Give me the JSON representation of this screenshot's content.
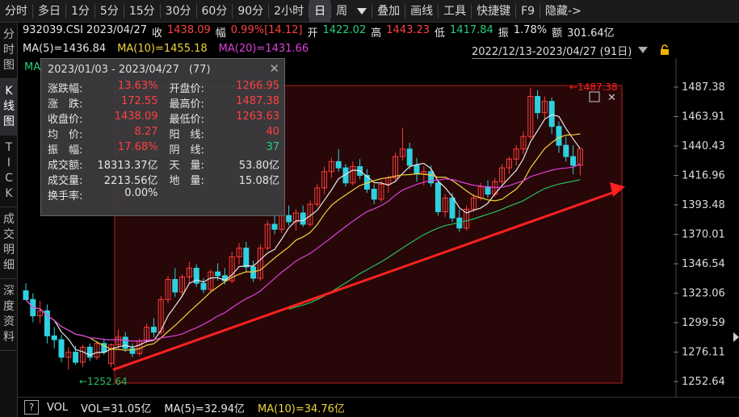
{
  "toolbar": {
    "items": [
      "分时",
      "多日",
      "1分",
      "5分",
      "15分",
      "30分",
      "60分",
      "90分",
      "2小时",
      "日",
      "周",
      "叠加",
      "画线",
      "工具",
      "快捷键",
      "F9",
      "隐藏->"
    ],
    "active": "日"
  },
  "leftbar": {
    "items": [
      "分时图",
      "K线图",
      "TICK",
      "成交明细",
      "深度资料"
    ],
    "active": "K线图"
  },
  "info": {
    "code_date": "932039.CSI 2023/04/27",
    "close_label": "收",
    "close": "1438.09",
    "change_label": "幅",
    "change": "0.99%[14.12]",
    "open_label": "开",
    "open": "1422.02",
    "high_label": "高",
    "high": "1443.23",
    "low_label": "低",
    "low": "1417.84",
    "amp_label": "振",
    "amp": "1.78%",
    "amount_label": "额",
    "amount": "301.64亿"
  },
  "ma": {
    "ma5": "MA(5)=1436.84",
    "ma10": "MA(10)=1455.18",
    "ma20": "MA(20)=1431.66",
    "ma_short": "MA"
  },
  "range": {
    "label": "2022/12/13-2023/04/27 (91日)"
  },
  "popup": {
    "start": "2023/01/03",
    "end": "2023/04/27",
    "count": "(77)",
    "rows": [
      [
        {
          "label": "涨跌幅:",
          "value": "13.63%",
          "color": "#ff4040"
        },
        {
          "label": "开盘价:",
          "value": "1266.95",
          "color": "#ff4040"
        }
      ],
      [
        {
          "label": "涨　跌:",
          "value": "172.55",
          "color": "#ff4040"
        },
        {
          "label": "最高价:",
          "value": "1487.38",
          "color": "#ff4040"
        }
      ],
      [
        {
          "label": "收盘价:",
          "value": "1438.09",
          "color": "#ff4040"
        },
        {
          "label": "最低价:",
          "value": "1263.63",
          "color": "#ff4040"
        }
      ],
      [
        {
          "label": "均　价:",
          "value": "8.27",
          "color": "#ff4040"
        },
        {
          "label": "阳　线:",
          "value": "40",
          "color": "#ff4040"
        }
      ],
      [
        {
          "label": "振　幅:",
          "value": "17.68%",
          "color": "#ff4040"
        },
        {
          "label": "阴　线:",
          "value": "37",
          "color": "#25d07a"
        }
      ],
      [
        {
          "label": "成交额:",
          "value": "18313.37亿",
          "color": "#e6e6e6"
        },
        {
          "label": "天　量:",
          "value": "53.80亿",
          "color": "#e6e6e6"
        }
      ],
      [
        {
          "label": "成交量:",
          "value": "2213.56亿",
          "color": "#e6e6e6"
        },
        {
          "label": "地　量:",
          "value": "15.08亿",
          "color": "#e6e6e6"
        }
      ],
      [
        {
          "label": "换手率:",
          "value": "0.00%",
          "color": "#e6e6e6"
        },
        {
          "label": "",
          "value": "",
          "color": "#e6e6e6"
        }
      ]
    ]
  },
  "volume": {
    "help": "?",
    "vol": "VOL",
    "vol_value": "VOL=31.05亿",
    "ma5": "MA(5)=32.94亿",
    "ma10": "MA(10)=34.76亿"
  },
  "chart_data": {
    "type": "candlestick",
    "y_ticks": [
      1487.38,
      1463.91,
      1440.43,
      1416.96,
      1393.48,
      1370.01,
      1346.54,
      1323.06,
      1299.59,
      1276.11,
      1252.64
    ],
    "ylim": [
      1250,
      1495
    ],
    "high_marker": "1487.38",
    "low_marker": "1252.64",
    "colors": {
      "up": "#ff3b3b",
      "down": "#2fd0e0",
      "ma5": "#e6e6e6",
      "ma10": "#f0d33a",
      "ma20": "#e040e0",
      "ma60": "#25c060",
      "arrow": "#ff2020",
      "selection": "#b02020"
    },
    "candles": [
      [
        1325,
        1331,
        1318,
        1318
      ],
      [
        1318,
        1323,
        1300,
        1305
      ],
      [
        1305,
        1317,
        1299,
        1309
      ],
      [
        1309,
        1314,
        1283,
        1289
      ],
      [
        1289,
        1296,
        1279,
        1286
      ],
      [
        1286,
        1290,
        1268,
        1272
      ],
      [
        1272,
        1280,
        1262,
        1276
      ],
      [
        1276,
        1281,
        1266,
        1268
      ],
      [
        1268,
        1282,
        1264,
        1280
      ],
      [
        1280,
        1283,
        1269,
        1272
      ],
      [
        1272,
        1285,
        1270,
        1283
      ],
      [
        1283,
        1287,
        1274,
        1276
      ],
      [
        1267,
        1283,
        1264,
        1282
      ],
      [
        1282,
        1294,
        1279,
        1288
      ],
      [
        1288,
        1292,
        1276,
        1279
      ],
      [
        1279,
        1283,
        1272,
        1275
      ],
      [
        1275,
        1287,
        1273,
        1285
      ],
      [
        1285,
        1299,
        1283,
        1296
      ],
      [
        1296,
        1303,
        1288,
        1292
      ],
      [
        1292,
        1321,
        1290,
        1318
      ],
      [
        1318,
        1337,
        1315,
        1334
      ],
      [
        1334,
        1343,
        1320,
        1324
      ],
      [
        1324,
        1338,
        1320,
        1336
      ],
      [
        1336,
        1348,
        1330,
        1343
      ],
      [
        1343,
        1346,
        1328,
        1331
      ],
      [
        1331,
        1335,
        1323,
        1326
      ],
      [
        1326,
        1342,
        1324,
        1340
      ],
      [
        1340,
        1347,
        1333,
        1337
      ],
      [
        1337,
        1343,
        1330,
        1333
      ],
      [
        1333,
        1356,
        1331,
        1352
      ],
      [
        1352,
        1363,
        1346,
        1359
      ],
      [
        1359,
        1364,
        1340,
        1344
      ],
      [
        1344,
        1349,
        1332,
        1335
      ],
      [
        1335,
        1362,
        1333,
        1359
      ],
      [
        1359,
        1381,
        1357,
        1378
      ],
      [
        1378,
        1386,
        1370,
        1374
      ],
      [
        1374,
        1388,
        1371,
        1385
      ],
      [
        1385,
        1393,
        1377,
        1380
      ],
      [
        1380,
        1390,
        1373,
        1387
      ],
      [
        1387,
        1393,
        1376,
        1378
      ],
      [
        1378,
        1397,
        1376,
        1394
      ],
      [
        1394,
        1410,
        1392,
        1407
      ],
      [
        1407,
        1424,
        1402,
        1420
      ],
      [
        1420,
        1431,
        1415,
        1428
      ],
      [
        1428,
        1438,
        1420,
        1423
      ],
      [
        1423,
        1426,
        1408,
        1411
      ],
      [
        1411,
        1428,
        1409,
        1424
      ],
      [
        1424,
        1430,
        1414,
        1417
      ],
      [
        1417,
        1422,
        1403,
        1406
      ],
      [
        1406,
        1410,
        1394,
        1398
      ],
      [
        1398,
        1413,
        1396,
        1410
      ],
      [
        1410,
        1417,
        1403,
        1415
      ],
      [
        1415,
        1435,
        1413,
        1432
      ],
      [
        1432,
        1455,
        1429,
        1438
      ],
      [
        1438,
        1443,
        1422,
        1425
      ],
      [
        1425,
        1431,
        1412,
        1418
      ],
      [
        1418,
        1424,
        1409,
        1420
      ],
      [
        1420,
        1425,
        1408,
        1411
      ],
      [
        1411,
        1413,
        1385,
        1388
      ],
      [
        1388,
        1402,
        1384,
        1399
      ],
      [
        1399,
        1403,
        1380,
        1383
      ],
      [
        1383,
        1390,
        1372,
        1375
      ],
      [
        1375,
        1393,
        1373,
        1390
      ],
      [
        1390,
        1402,
        1388,
        1399
      ],
      [
        1399,
        1411,
        1397,
        1408
      ],
      [
        1408,
        1413,
        1399,
        1402
      ],
      [
        1402,
        1415,
        1400,
        1412
      ],
      [
        1412,
        1426,
        1410,
        1423
      ],
      [
        1423,
        1432,
        1418,
        1430
      ],
      [
        1430,
        1441,
        1425,
        1438
      ],
      [
        1438,
        1452,
        1434,
        1448
      ],
      [
        1448,
        1487,
        1446,
        1480
      ],
      [
        1480,
        1485,
        1462,
        1467
      ],
      [
        1467,
        1480,
        1462,
        1476
      ],
      [
        1476,
        1479,
        1450,
        1456
      ],
      [
        1456,
        1460,
        1435,
        1441
      ],
      [
        1441,
        1448,
        1428,
        1432
      ],
      [
        1432,
        1441,
        1418,
        1425
      ],
      [
        1425,
        1437,
        1417,
        1438
      ]
    ]
  }
}
